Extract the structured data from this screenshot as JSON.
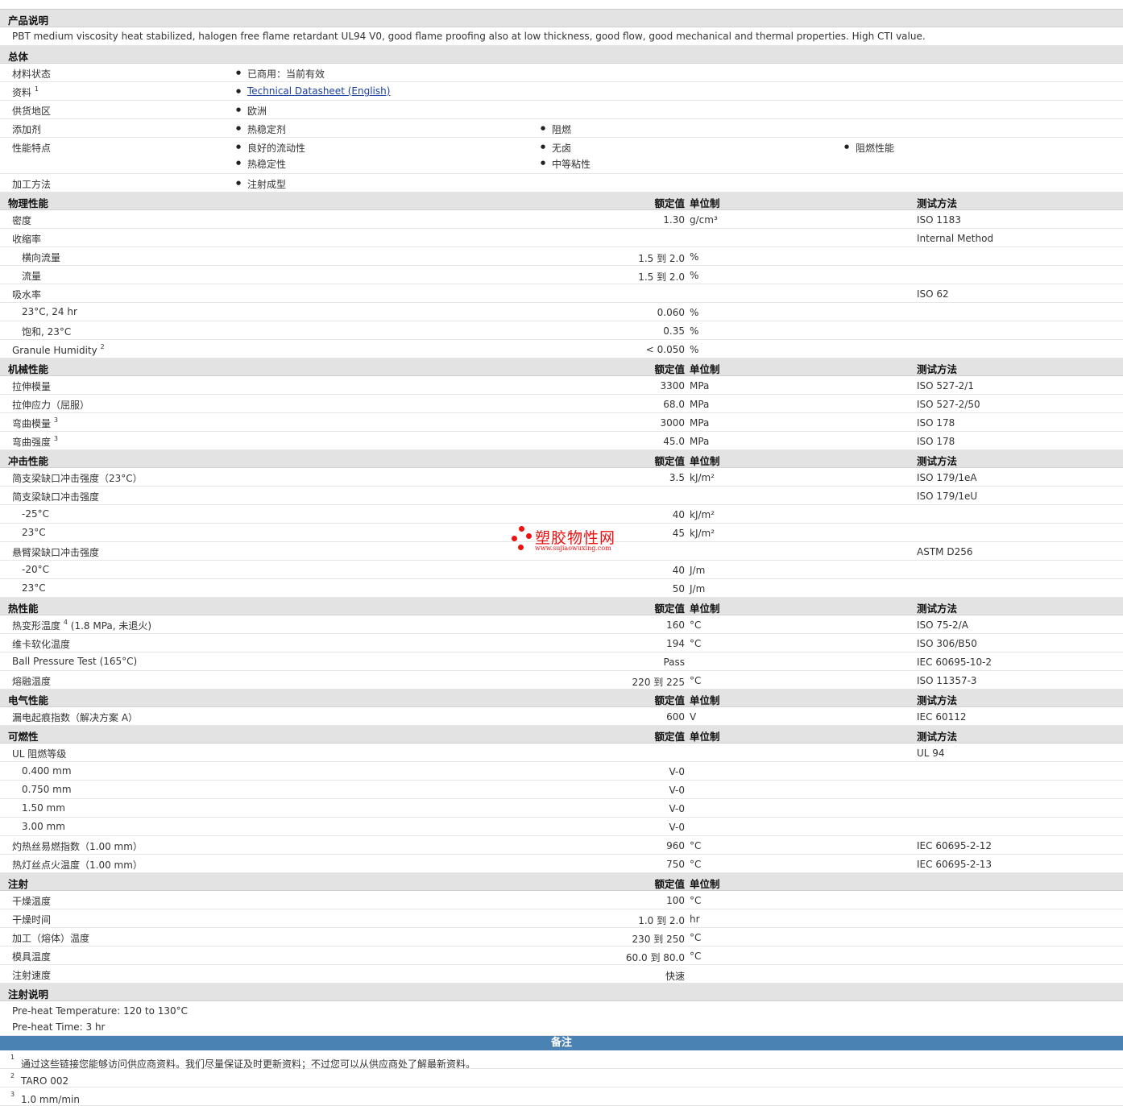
{
  "desc_section": "产品说明",
  "description": "PBT medium viscosity heat stabilized, halogen free flame retardant UL94 V0, good flame proofing also at low thickness, good flow, good mechanical and thermal properties. High CTI value.",
  "general": {
    "title": "总体",
    "material_status_label": "材料状态",
    "material_status": "已商用：当前有效",
    "docs_label": "资料",
    "docs_sup": "1",
    "docs_link": "Technical Datasheet (English)",
    "region_label": "供货地区",
    "region": "欧洲",
    "additive_label": "添加剂",
    "additives": [
      "热稳定剂",
      "阻燃"
    ],
    "features_label": "性能特点",
    "features": [
      "良好的流动性",
      "无卤",
      "阻燃性能",
      "热稳定性",
      "中等粘性"
    ],
    "process_label": "加工方法",
    "process": "注射成型"
  },
  "headers": {
    "value": "额定值",
    "unit": "单位制",
    "method": "测试方法"
  },
  "physical": {
    "title": "物理性能",
    "density_label": "密度",
    "density_val": "1.30",
    "density_unit": "g/cm³",
    "density_method": "ISO 1183",
    "shrink_label": "收缩率",
    "shrink_method": "Internal Method",
    "shrink_cross_label": "横向流量",
    "shrink_cross_val": "1.5 到  2.0",
    "shrink_cross_unit": "%",
    "shrink_flow_label": "流量",
    "shrink_flow_val": "1.5 到  2.0",
    "shrink_flow_unit": "%",
    "water_label": "吸水率",
    "water_method": "ISO 62",
    "water_24_label": "23°C, 24 hr",
    "water_24_val": "0.060",
    "water_24_unit": "%",
    "water_sat_label": "饱和, 23°C",
    "water_sat_val": "0.35",
    "water_sat_unit": "%",
    "granule_label": "Granule Humidity",
    "granule_sup": "2",
    "granule_val": "< 0.050",
    "granule_unit": "%"
  },
  "mechanical": {
    "title": "机械性能",
    "tm_label": "拉伸模量",
    "tm_val": "3300",
    "tm_unit": "MPa",
    "tm_method": "ISO 527-2/1",
    "ts_label": "拉伸应力（屈服）",
    "ts_val": "68.0",
    "ts_unit": "MPa",
    "ts_method": "ISO 527-2/50",
    "fm_label": "弯曲模量",
    "fm_sup": "3",
    "fm_val": "3000",
    "fm_unit": "MPa",
    "fm_method": "ISO 178",
    "fs_label": "弯曲强度",
    "fs_sup": "3",
    "fs_val": "45.0",
    "fs_unit": "MPa",
    "fs_method": "ISO 178"
  },
  "impact": {
    "title": "冲击性能",
    "charpy_n_label": "简支梁缺口冲击强度（23°C）",
    "charpy_n_val": "3.5",
    "charpy_n_unit": "kJ/m²",
    "charpy_n_method": "ISO 179/1eA",
    "charpy_u_label": "简支梁缺口冲击强度",
    "charpy_u_method": "ISO 179/1eU",
    "cu_m25_label": "-25°C",
    "cu_m25_val": "40",
    "cu_m25_unit": "kJ/m²",
    "cu_23_label": "23°C",
    "cu_23_val": "45",
    "cu_23_unit": "kJ/m²",
    "izod_label": "悬臂梁缺口冲击强度",
    "izod_method": "ASTM D256",
    "iz_m20_label": "-20°C",
    "iz_m20_val": "40",
    "iz_m20_unit": "J/m",
    "iz_23_label": "23°C",
    "iz_23_val": "50",
    "iz_23_unit": "J/m"
  },
  "thermal": {
    "title": "热性能",
    "hdt_label": "热变形温度",
    "hdt_sup": "4",
    "hdt_cond": "(1.8 MPa, 未退火)",
    "hdt_val": "160",
    "hdt_unit": "°C",
    "hdt_method": "ISO 75-2/A",
    "vicat_label": "维卡软化温度",
    "vicat_val": "194",
    "vicat_unit": "°C",
    "vicat_method": "ISO 306/B50",
    "ball_label": "Ball Pressure Test (165°C)",
    "ball_val": "Pass",
    "ball_method": "IEC 60695-10-2",
    "melt_label": "熔融温度",
    "melt_val": "220 到  225",
    "melt_unit": "°C",
    "melt_method": "ISO 11357-3"
  },
  "electrical": {
    "title": "电气性能",
    "cti_label": "漏电起痕指数（解决方案  A）",
    "cti_val": "600",
    "cti_unit": "V",
    "cti_method": "IEC 60112"
  },
  "flammability": {
    "title": "可燃性",
    "ul_label": "UL 阻燃等级",
    "ul_method": "UL 94",
    "ul_rows": [
      {
        "label": "0.400 mm",
        "val": "V-0"
      },
      {
        "label": "0.750 mm",
        "val": "V-0"
      },
      {
        "label": "1.50 mm",
        "val": "V-0"
      },
      {
        "label": "3.00 mm",
        "val": "V-0"
      }
    ],
    "gwfi_label": "灼热丝易燃指数（1.00 mm）",
    "gwfi_val": "960",
    "gwfi_unit": "°C",
    "gwfi_method": "IEC 60695-2-12",
    "gwit_label": "热灯丝点火温度（1.00 mm）",
    "gwit_val": "750",
    "gwit_unit": "°C",
    "gwit_method": "IEC 60695-2-13"
  },
  "injection": {
    "title": "注射",
    "dry_t_label": "干燥温度",
    "dry_t_val": "100",
    "dry_t_unit": "°C",
    "dry_h_label": "干燥时间",
    "dry_h_val": "1.0 到  2.0",
    "dry_h_unit": "hr",
    "melt_label": "加工（熔体）温度",
    "melt_val": "230 到  250",
    "melt_unit": "°C",
    "mold_label": "模具温度",
    "mold_val": "60.0 到  80.0",
    "mold_unit": "°C",
    "speed_label": "注射速度",
    "speed_val": "快速"
  },
  "injection_notes": {
    "title": "注射说明",
    "line1": "Pre-heat Temperature: 120 to 130°C",
    "line2": "Pre-heat Time: 3 hr"
  },
  "notes": {
    "title": "备注",
    "n1_sup": "1",
    "n1": "通过这些链接您能够访问供应商资料。我们尽量保证及时更新资料；不过您可以从供应商处了解最新资料。",
    "n2_sup": "2",
    "n2": "TARO 002",
    "n3_sup": "3",
    "n3": "1.0 mm/min"
  },
  "watermark": {
    "name": "塑胶物性网",
    "url": "www.sujiaowuxing.com",
    "color": "#e11111"
  }
}
